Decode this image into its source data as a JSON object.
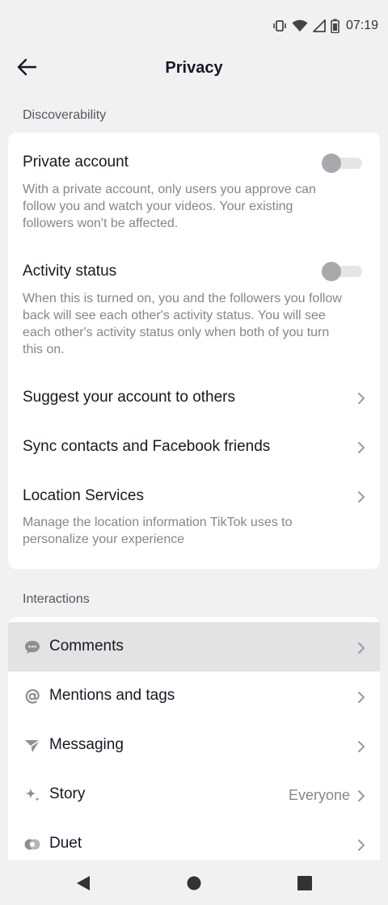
{
  "status_bar": {
    "time": "07:19",
    "icons": [
      "vibrate-icon",
      "wifi-icon",
      "signal-icon",
      "battery-icon"
    ]
  },
  "header": {
    "title": "Privacy",
    "back_icon": "back-arrow-icon"
  },
  "discoverability": {
    "label": "Discoverability",
    "private_account": {
      "title": "Private account",
      "description": "With a private account, only users you approve can follow you and watch your videos. Your existing followers won't be affected.",
      "enabled": false
    },
    "activity_status": {
      "title": "Activity status",
      "description": "When this is turned on, you and the followers you follow back will see each other's activity status. You will see each other's activity status only when both of you turn this on.",
      "enabled": false
    },
    "suggest_account": {
      "title": "Suggest your account to others"
    },
    "sync_contacts": {
      "title": "Sync contacts and Facebook friends"
    },
    "location_services": {
      "title": "Location Services",
      "description": "Manage the location information TikTok uses to personalize your experience"
    }
  },
  "interactions": {
    "label": "Interactions",
    "items": [
      {
        "label": "Comments",
        "icon": "comment-bubble-icon",
        "value": ""
      },
      {
        "label": "Mentions and tags",
        "icon": "at-sign-icon",
        "value": ""
      },
      {
        "label": "Messaging",
        "icon": "send-message-icon",
        "value": ""
      },
      {
        "label": "Story",
        "icon": "sparkle-icon",
        "value": "Everyone"
      },
      {
        "label": "Duet",
        "icon": "duet-icon",
        "value": ""
      }
    ]
  },
  "colors": {
    "background": "#f1f1f2",
    "card": "#ffffff",
    "text_primary": "#161823",
    "text_secondary": "#85868c",
    "highlight_row": "#e3e3e4"
  }
}
